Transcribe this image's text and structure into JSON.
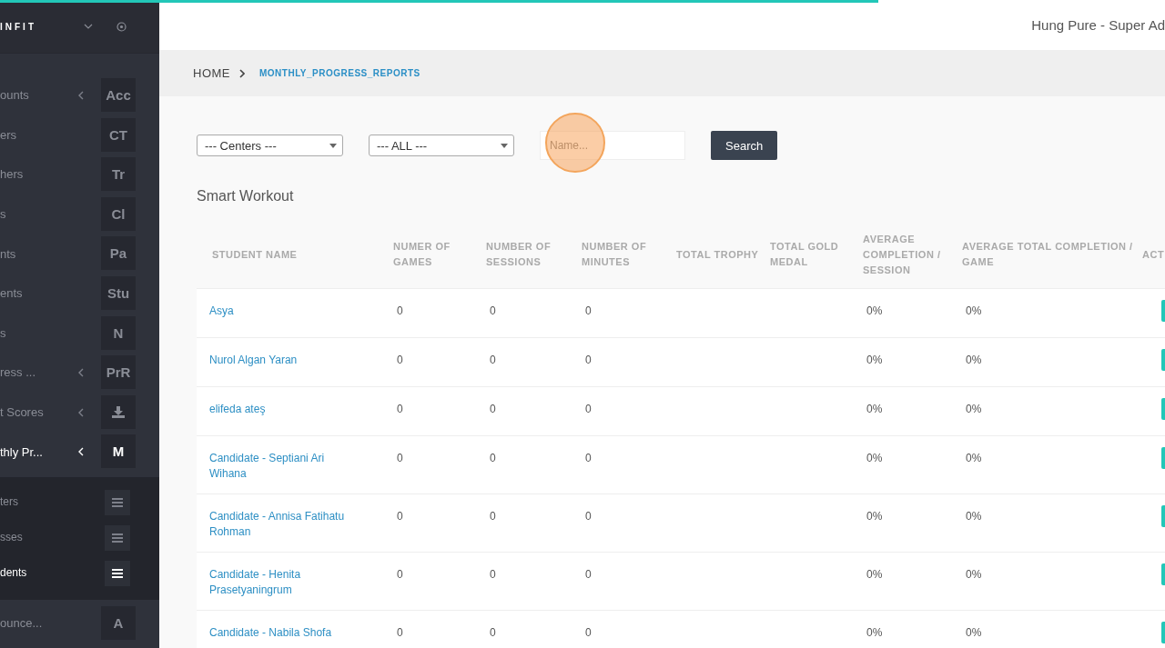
{
  "loading_bar": {
    "level": 0.754
  },
  "sidebar": {
    "logo": "INFIT",
    "items": [
      {
        "label": "ounts",
        "icon_text": "Acc",
        "expandable": true,
        "selected": false
      },
      {
        "label": "ers",
        "icon_text": "CT",
        "expandable": false,
        "selected": false
      },
      {
        "label": "hers",
        "icon_text": "Tr",
        "expandable": false,
        "selected": false
      },
      {
        "label": "s",
        "icon_text": "Cl",
        "expandable": false,
        "selected": false
      },
      {
        "label": "nts",
        "icon_text": "Pa",
        "expandable": false,
        "selected": false
      },
      {
        "label": "ents",
        "icon_text": "Stu",
        "expandable": false,
        "selected": false
      },
      {
        "label": "s",
        "icon_text": "N",
        "expandable": false,
        "selected": false
      },
      {
        "label": "ress ...",
        "icon_text": "PrR",
        "expandable": true,
        "selected": false
      },
      {
        "label": "t Scores",
        "kind": "download",
        "expandable": true,
        "selected": false
      },
      {
        "label": "thly Pr...",
        "icon_text": "M",
        "expandable": true,
        "selected": true,
        "children": [
          {
            "label": "ters",
            "selected": false
          },
          {
            "label": "sses",
            "selected": false
          },
          {
            "label": "dents",
            "selected": true
          }
        ]
      },
      {
        "label": "ounce...",
        "icon_text": "A",
        "expandable": false,
        "selected": false
      }
    ]
  },
  "header": {
    "user": "Hung Pure - Super Ad"
  },
  "breadcrumb": [
    {
      "label": "HOME"
    },
    {
      "label": "MONTHLY_PROGRESS_REPORTS"
    }
  ],
  "filters": {
    "centers": "--- Centers ---",
    "group": "--- ALL ---",
    "name_placeholder": "Name...",
    "search_button": "Search"
  },
  "section_title": "Smart Workout",
  "table": {
    "columns": [
      "STUDENT NAME",
      "NUMER OF GAMES",
      "NUMBER OF SESSIONS",
      "NUMBER OF MINUTES",
      "TOTAL TROPHY",
      "TOTAL GOLD MEDAL",
      "AVERAGE COMPLETION / SESSION",
      "AVERAGE TOTAL COMPLETION / GAME",
      "ACT"
    ],
    "rows": [
      {
        "name": "Asya",
        "games": "0",
        "sessions": "0",
        "minutes": "0",
        "avg_session": "0%",
        "avg_game": "0%"
      },
      {
        "name": "Nurol Algan Yaran",
        "games": "0",
        "sessions": "0",
        "minutes": "0",
        "avg_session": "0%",
        "avg_game": "0%"
      },
      {
        "name": "elifeda ateş",
        "games": "0",
        "sessions": "0",
        "minutes": "0",
        "avg_session": "0%",
        "avg_game": "0%"
      },
      {
        "name": "Candidate - Septiani Ari Wihana",
        "games": "0",
        "sessions": "0",
        "minutes": "0",
        "avg_session": "0%",
        "avg_game": "0%"
      },
      {
        "name": "Candidate - Annisa Fatihatu Rohman",
        "games": "0",
        "sessions": "0",
        "minutes": "0",
        "avg_session": "0%",
        "avg_game": "0%"
      },
      {
        "name": "Candidate - Henita Prasetyaningrum",
        "games": "0",
        "sessions": "0",
        "minutes": "0",
        "avg_session": "0%",
        "avg_game": "0%"
      },
      {
        "name": "Candidate - Nabila Shofa",
        "games": "0",
        "sessions": "0",
        "minutes": "0",
        "avg_session": "0%",
        "avg_game": "0%"
      }
    ]
  }
}
